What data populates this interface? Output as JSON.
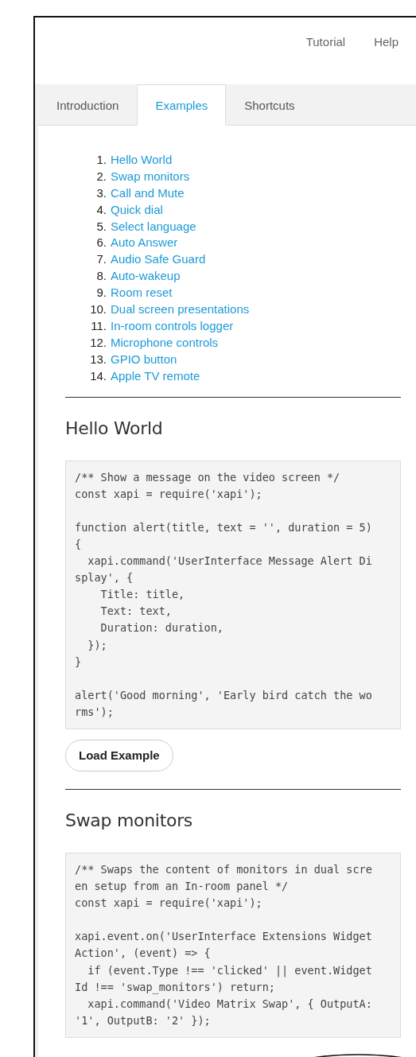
{
  "header": {
    "links": [
      "Tutorial",
      "Help"
    ]
  },
  "tabs": [
    {
      "label": "Introduction",
      "selected": false
    },
    {
      "label": "Examples",
      "selected": true
    },
    {
      "label": "Shortcuts",
      "selected": false
    }
  ],
  "examples_index": [
    {
      "number": "1.",
      "title": "Hello World"
    },
    {
      "number": "2.",
      "title": "Swap monitors"
    },
    {
      "number": "3.",
      "title": "Call and Mute"
    },
    {
      "number": "4.",
      "title": "Quick dial"
    },
    {
      "number": "5.",
      "title": "Select language"
    },
    {
      "number": "6.",
      "title": "Auto Answer"
    },
    {
      "number": "7.",
      "title": "Audio Safe Guard"
    },
    {
      "number": "8.",
      "title": "Auto-wakeup"
    },
    {
      "number": "9.",
      "title": "Room reset"
    },
    {
      "number": "10.",
      "title": "Dual screen presentations"
    },
    {
      "number": "11.",
      "title": "In-room controls logger"
    },
    {
      "number": "12.",
      "title": "Microphone controls"
    },
    {
      "number": "13.",
      "title": "GPIO button"
    },
    {
      "number": "14.",
      "title": "Apple TV remote"
    }
  ],
  "examples": [
    {
      "title": "Hello World",
      "code": "/** Show a message on the video screen */\nconst xapi = require('xapi');\n\nfunction alert(title, text = '', duration = 5)\n{\n  xapi.command('UserInterface Message Alert Di\nsplay', {\n    Title: title,\n    Text: text,\n    Duration: duration,\n  });\n}\n\nalert('Good morning', 'Early bird catch the wo\nrms');",
      "button": "Load Example"
    },
    {
      "title": "Swap monitors",
      "code": "/** Swaps the content of monitors in dual scre\nen setup from an In-room panel */\nconst xapi = require('xapi');\n\nxapi.event.on('UserInterface Extensions Widget\nAction', (event) => {\n  if (event.Type !== 'clicked' || event.Widget\nId !== 'swap_monitors') return;\n  xapi.command('Video Matrix Swap', { OutputA:\n'1', OutputB: '2' });"
    }
  ]
}
